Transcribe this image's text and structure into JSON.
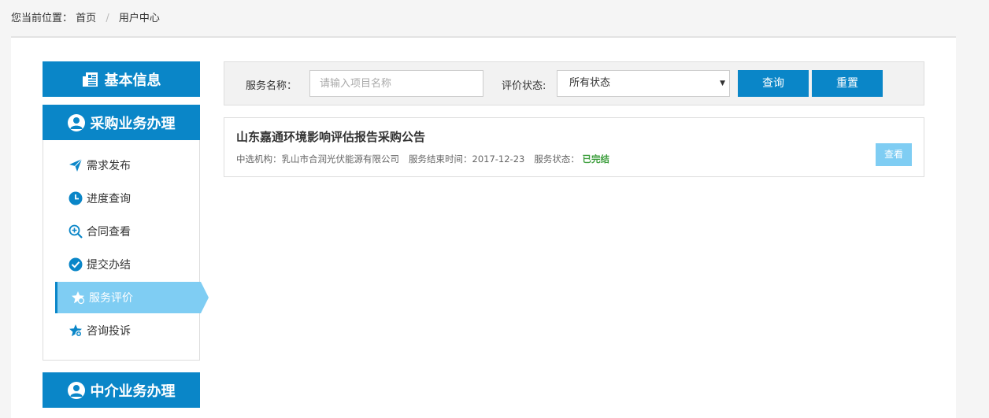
{
  "breadcrumb": {
    "prefix": "您当前位置：",
    "home": "首页",
    "separator": "/",
    "current": "用户中心"
  },
  "sidebar": {
    "sections": [
      {
        "label": "基本信息",
        "icon": "newspaper-icon"
      },
      {
        "label": "采购业务办理",
        "icon": "user-icon"
      },
      {
        "label": "中介业务办理",
        "icon": "user-icon"
      }
    ],
    "items": [
      {
        "label": "需求发布",
        "icon": "paper-plane-icon",
        "active": false
      },
      {
        "label": "进度查询",
        "icon": "clock-icon",
        "active": false
      },
      {
        "label": "合同查看",
        "icon": "zoom-in-icon",
        "active": false
      },
      {
        "label": "提交办结",
        "icon": "check-circle-icon",
        "active": false
      },
      {
        "label": "服务评价",
        "icon": "star-icon",
        "active": true
      },
      {
        "label": "咨询投诉",
        "icon": "star-badge-icon",
        "active": false
      }
    ]
  },
  "search": {
    "name_label": "服务名称：",
    "name_value": "",
    "name_placeholder": "请输入项目名称",
    "status_label": "评价状态:",
    "status_selected": "所有状态",
    "query_label": "查询",
    "reset_label": "重置"
  },
  "results": [
    {
      "title": "山东嘉通环境影响评估报告采购公告",
      "org_label": "中选机构：",
      "org_value": "乳山市合润光伏能源有限公司",
      "end_label": "服务结束时间：",
      "end_value": "2017-12-23",
      "status_label": "服务状态：",
      "status_value": "已完结",
      "view_label": "查看"
    }
  ],
  "colors": {
    "primary": "#0a86c8",
    "active": "#7fcdf3",
    "success": "#3c9e3c"
  }
}
